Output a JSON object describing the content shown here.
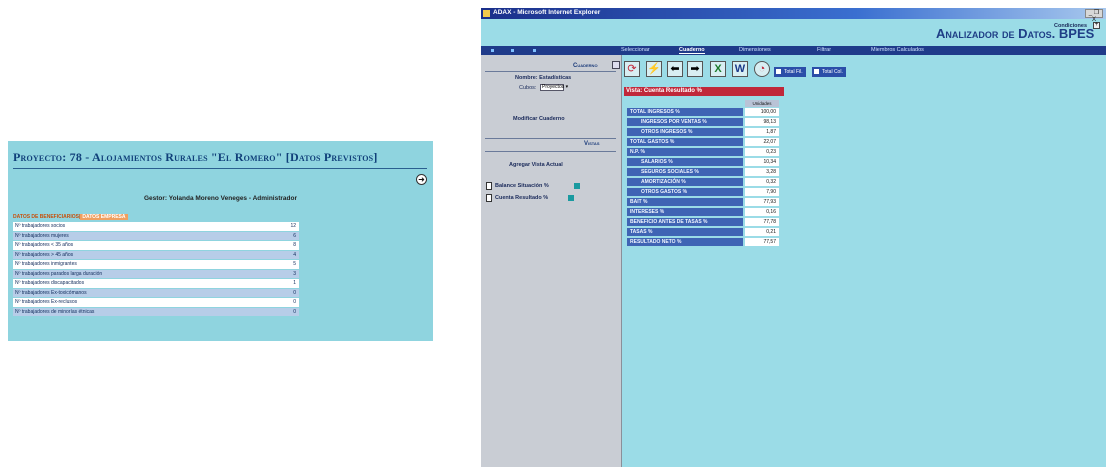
{
  "left_panel": {
    "title": "Proyecto: 78 - Alojamientos Rurales \"El Romero\" [Datos Previstos]",
    "gestor": "Gestor: Yolanda Moreno Veneges - Administrador",
    "tabs": [
      "DATOS DE BENEFICIARIOS",
      "DATOS EMPRESA"
    ],
    "rows": [
      {
        "label": "Nº trabajadores socios",
        "value": "12"
      },
      {
        "label": "Nº trabajadores mujeres",
        "value": "6"
      },
      {
        "label": "Nº trabajadores < 35 años",
        "value": "8"
      },
      {
        "label": "Nº trabajadores > 45 años",
        "value": "4"
      },
      {
        "label": "Nº trabajadores inmigrantes",
        "value": "5"
      },
      {
        "label": "Nº trabajadores parados larga duración",
        "value": "3"
      },
      {
        "label": "Nº trabajadores discapacitados",
        "value": "1"
      },
      {
        "label": "Nº trabajadores Ex-toxicómanos",
        "value": "0"
      },
      {
        "label": "Nº trabajadores Ex-reclusos",
        "value": "0"
      },
      {
        "label": "Nº trabajadores de minorías étnicas",
        "value": "0"
      }
    ]
  },
  "window": {
    "title": "ADAX - Microsoft Internet Explorer",
    "controls": "_ ❐ X",
    "brand": "Analizador de Datos. BPES",
    "nav": [
      "Seleccionar",
      "Cuaderno",
      "Dimensiones",
      "Filtrar",
      "Miembros Calculados"
    ],
    "nav_active": "Cuaderno",
    "sidebar": {
      "cuaderno_header": "Cuaderno",
      "nombre": "Nombre: Estadísticas",
      "cubos_label": "Cubos:",
      "cubos_value": "Proyectos",
      "modificar": "Modificar Cuaderno",
      "vistas_header": "Vistas",
      "agregar": "Agregar Vista Actual",
      "views": [
        "Balance Situación %",
        "Cuenta Resultado %"
      ]
    },
    "toolbar": {
      "total_fil": "Total Fil.",
      "total_col": "Total Col.",
      "condiciones": "Condiciones"
    },
    "vista_title": "Vista: Cuenta Resultado %",
    "column_header": "Unidades",
    "rows": [
      {
        "label": "TOTAL INGRESOS %",
        "value": "100,00",
        "indent": 0
      },
      {
        "label": "INGRESOS POR VENTAS %",
        "value": "98,13",
        "indent": 1
      },
      {
        "label": "OTROS INGRESOS %",
        "value": "1,87",
        "indent": 1
      },
      {
        "label": "TOTAL GASTOS %",
        "value": "22,07",
        "indent": 0
      },
      {
        "label": "N.P. %",
        "value": "0,23",
        "indent": 0
      },
      {
        "label": "SALARIOS %",
        "value": "10,34",
        "indent": 1
      },
      {
        "label": "SEGUROS SOCIALES %",
        "value": "3,28",
        "indent": 1
      },
      {
        "label": "AMORTIZACIÓN %",
        "value": "0,32",
        "indent": 1
      },
      {
        "label": "OTROS GASTOS %",
        "value": "7,90",
        "indent": 1
      },
      {
        "label": "BAIT %",
        "value": "77,93",
        "indent": 0
      },
      {
        "label": "INTERESES %",
        "value": "0,16",
        "indent": 0
      },
      {
        "label": "BENEFICIO ANTES DE TASAS %",
        "value": "77,78",
        "indent": 0
      },
      {
        "label": "TASAS %",
        "value": "0,21",
        "indent": 0
      },
      {
        "label": "RESULTADO NETO %",
        "value": "77,57",
        "indent": 0
      }
    ]
  }
}
